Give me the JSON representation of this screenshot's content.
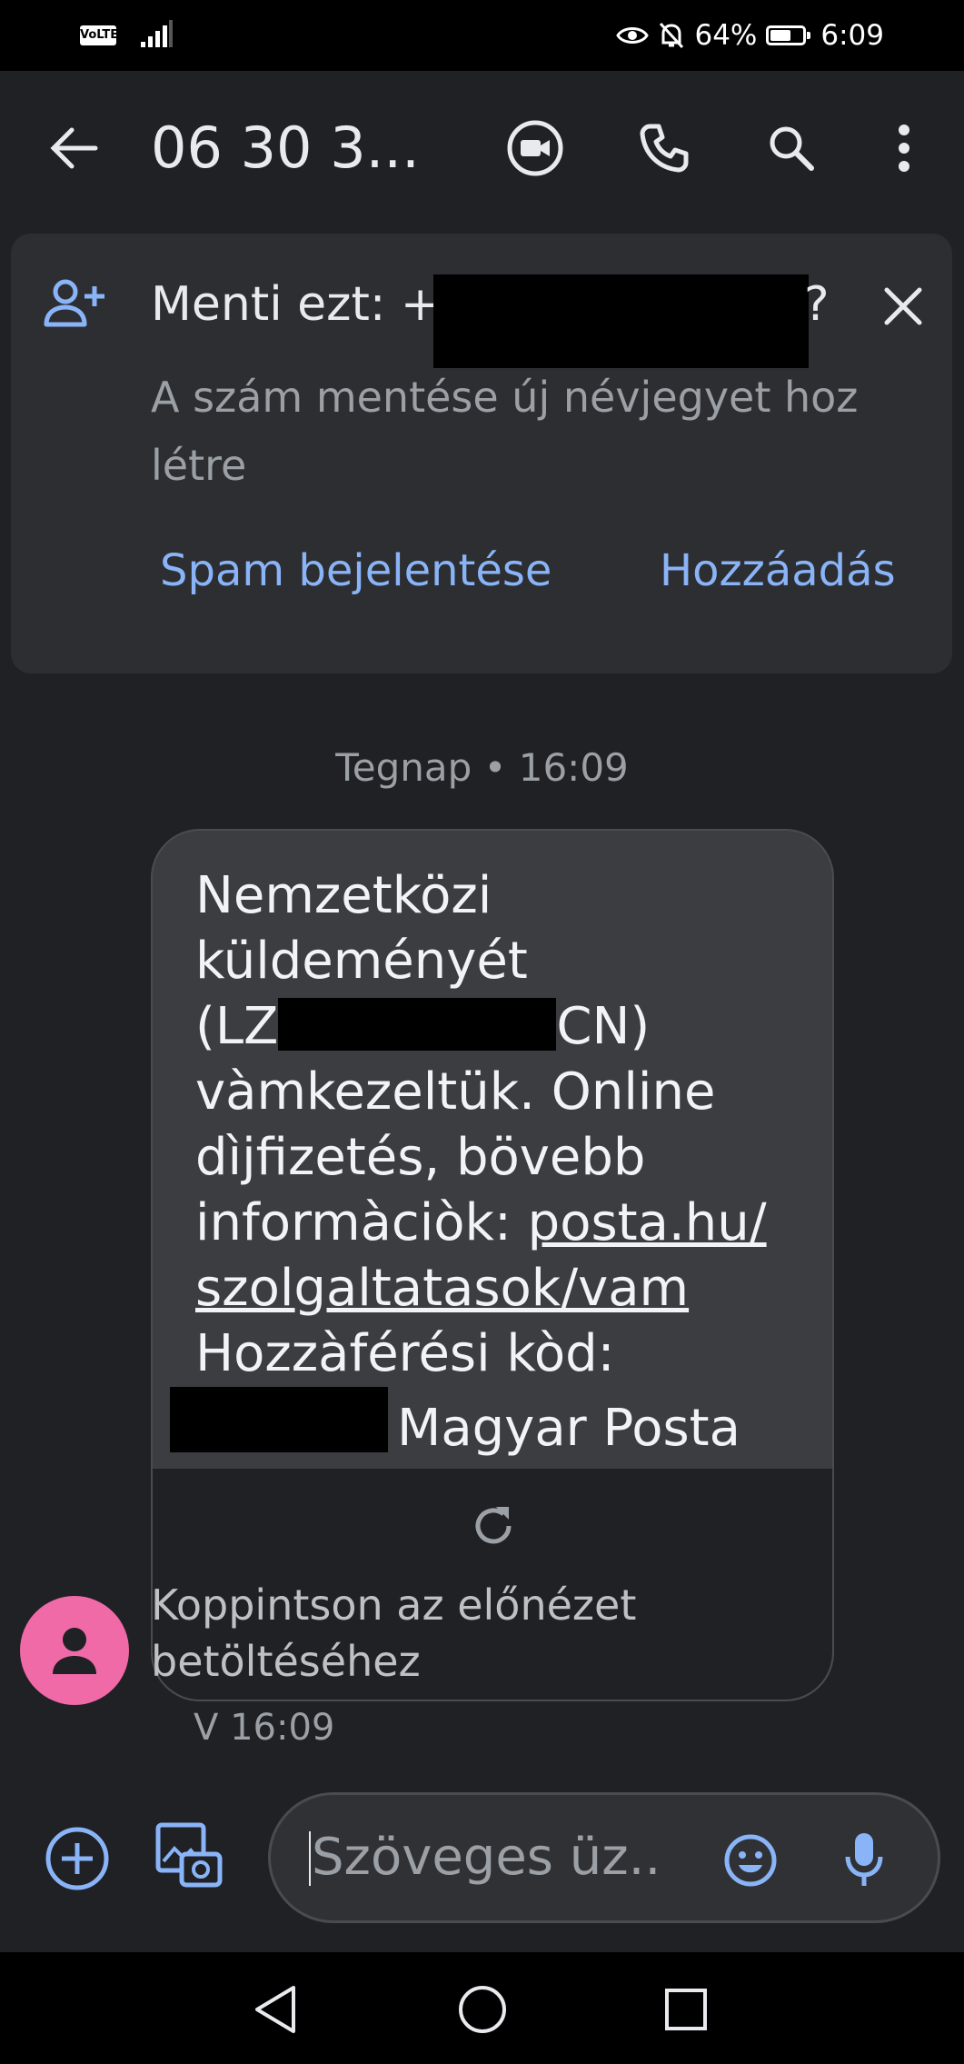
{
  "status_bar": {
    "volte": "VoLTE",
    "battery_percent": "64%",
    "battery_level": 0.64,
    "time": "6:09"
  },
  "app_bar": {
    "title": "06 30 3..."
  },
  "save_card": {
    "title": "Menti ezt: +",
    "title_suffix": "?",
    "subtitle": "A szám mentése új névjegyet hoz létre",
    "spam_label": "Spam bejelentése",
    "add_label": "Hozzáadás"
  },
  "conversation": {
    "date_separator": "Tegnap • 16:09",
    "message": {
      "line1": "Nemzetközi küldeményét",
      "code_prefix": "(LZ",
      "code_suffix": "CN)",
      "line2": "vàmkezeltük. Online dìjfizetés, bövebb informàciòk:",
      "link": "posta.hu/ szolgaltatasok/vam",
      "line3": "Hozzàférési kòd:",
      "sender_sign": "Magyar Posta"
    },
    "preview_hint": "Koppintson az előnézet betöltéséhez",
    "meta": "V 16:09"
  },
  "compose": {
    "placeholder": "Szöveges üz..."
  },
  "colors": {
    "background": "#202124",
    "accent": "#8ab4f8",
    "bubble": "#3c3d41",
    "avatar": "#f06aa8"
  }
}
